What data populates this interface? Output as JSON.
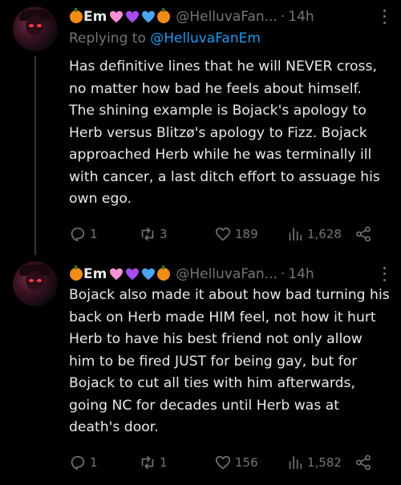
{
  "tweets": [
    {
      "display_name": "Em",
      "handle": "@HelluvaFan...",
      "time": "14h",
      "replying_label": "Replying to",
      "replying_mention": "@HelluvaFanEm",
      "text": "Has definitive lines that he will NEVER cross, no matter how bad he feels about himself. The shining example is Bojack's apology to Herb versus Blitzø's apology to Fizz. Bojack approached Herb while he was terminally ill with cancer, a last ditch effort to assuage his own ego.",
      "replies": "1",
      "reposts": "3",
      "likes": "189",
      "views": "1,628"
    },
    {
      "display_name": "Em",
      "handle": "@HelluvaFan...",
      "time": "14h",
      "text": "Bojack also made it about how bad turning his back on Herb made HIM feel, not how it hurt Herb to have his best friend not only allow him to be fired JUST for being gay, but for Bojack to cut all ties with him afterwards, going NC for decades until Herb was at death's door.",
      "replies": "1",
      "reposts": "1",
      "likes": "156",
      "views": "1,582"
    }
  ],
  "emoji_icons": [
    "pumpkin-icon",
    "pink-heart-icon",
    "purple-heart-icon",
    "blue-heart-icon",
    "pumpkin-icon"
  ],
  "colors": {
    "background": "#000000",
    "text": "#e7e9ea",
    "secondary": "#71767b",
    "link": "#1d9bf0",
    "pink_heart": "#f78fd6",
    "purple_heart": "#a64cf0",
    "blue_heart": "#4aa6ef",
    "pumpkin": "#f28c18"
  }
}
